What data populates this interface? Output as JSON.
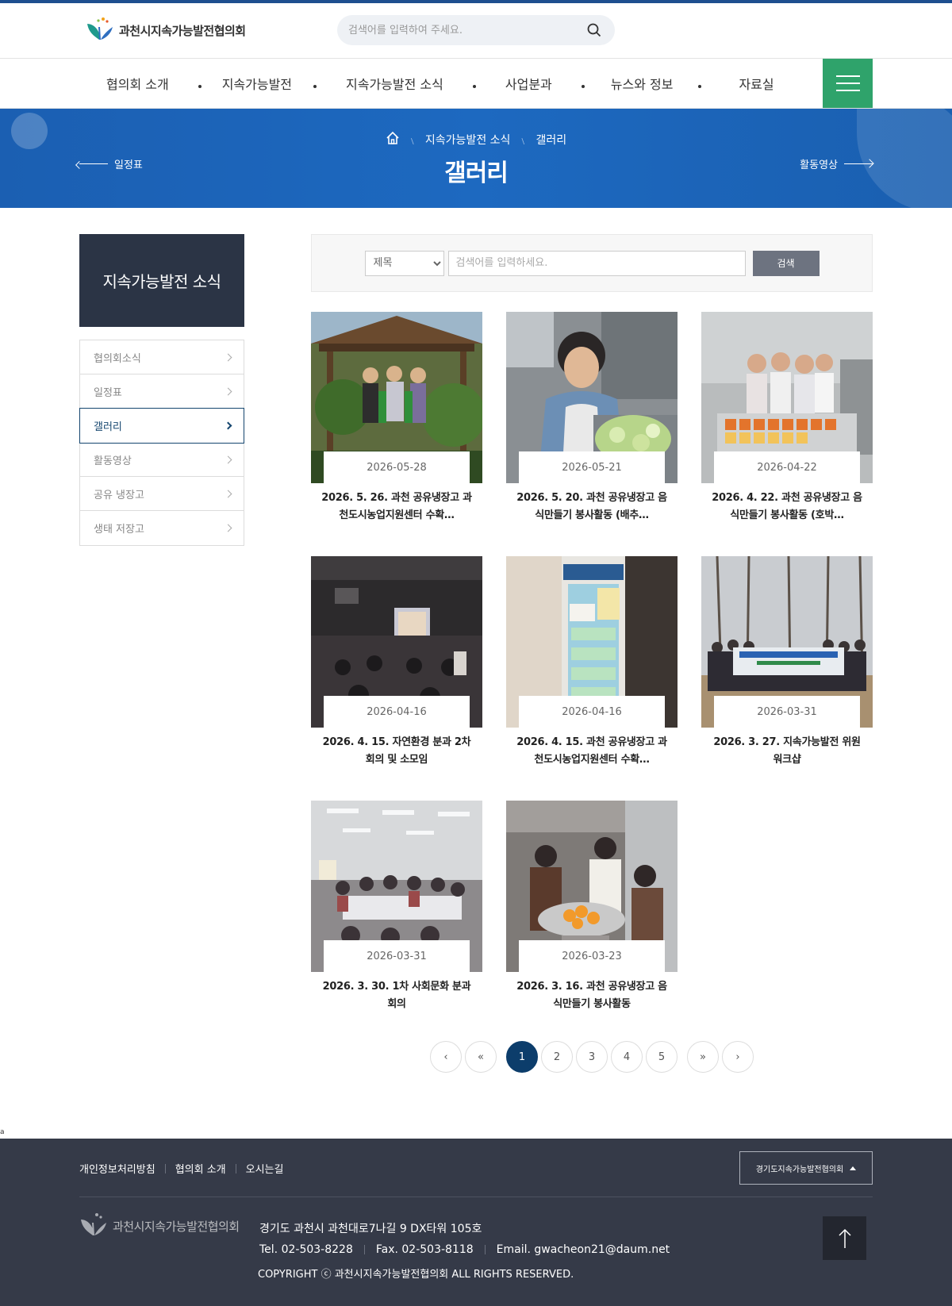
{
  "header": {
    "logo_text": "과천시지속가능발전협의회",
    "search_placeholder": "검색어를 입력하여 주세요."
  },
  "nav": {
    "items": [
      "협의회 소개",
      "지속가능발전",
      "지속가능발전 소식",
      "사업분과",
      "뉴스와 정보",
      "자료실"
    ]
  },
  "banner": {
    "breadcrumb": [
      "지속가능발전 소식",
      "갤러리"
    ],
    "title": "갤러리",
    "prev_label": "일정표",
    "next_label": "활동영상"
  },
  "sidebar": {
    "title": "지속가능발전 소식",
    "items": [
      {
        "label": "협의회소식",
        "active": false
      },
      {
        "label": "일정표",
        "active": false
      },
      {
        "label": "갤러리",
        "active": true
      },
      {
        "label": "활동영상",
        "active": false
      },
      {
        "label": "공유 냉장고",
        "active": false
      },
      {
        "label": "생태 저장고",
        "active": false
      }
    ]
  },
  "board_search": {
    "select_value": "제목",
    "input_placeholder": "검색어를 입력하세요.",
    "button_label": "검색"
  },
  "gallery": [
    {
      "date": "2026-05-28",
      "title": "2026. 5. 26. 과천 공유냉장고 과천도시농업지원센터 수확…",
      "scene": "garden"
    },
    {
      "date": "2026-05-21",
      "title": "2026. 5. 20. 과천 공유냉장고 음식만들기 봉사활동 (배추…",
      "scene": "kitchen"
    },
    {
      "date": "2026-04-22",
      "title": "2026. 4. 22. 과천 공유냉장고 음식만들기 봉사활동 (호박…",
      "scene": "group-kitchen"
    },
    {
      "date": "2026-04-16",
      "title": "2026. 4. 15. 자연환경 분과 2차 회의 및 소모임",
      "scene": "meeting-dark"
    },
    {
      "date": "2026-04-16",
      "title": "2026. 4. 15. 과천 공유냉장고 과천도시농업지원센터 수확…",
      "scene": "fridge"
    },
    {
      "date": "2026-03-31",
      "title": "2026. 3. 27. 지속가능발전 위원워크샵",
      "scene": "outdoor-group"
    },
    {
      "date": "2026-03-31",
      "title": "2026. 3. 30. 1차 사회문화 분과 회의",
      "scene": "meeting-room"
    },
    {
      "date": "2026-03-23",
      "title": "2026. 3. 16. 과천 공유냉장고 음식만들기 봉사활동",
      "scene": "cooking"
    }
  ],
  "pagination": {
    "prev": "‹",
    "first": "«",
    "pages": [
      "1",
      "2",
      "3",
      "4",
      "5"
    ],
    "current": "1",
    "last": "»",
    "next": "›"
  },
  "stray_text": "a",
  "footer": {
    "links": [
      "개인정보처리방침",
      "협의회 소개",
      "오시는길"
    ],
    "family_site": "경기도지속가능발전협의회",
    "logo_text": "과천시지속가능발전협의회",
    "address": "경기도 과천시 과천대로7나길 9 DX타워 105호",
    "tel": "Tel. 02-503-8228",
    "fax": "Fax. 02-503-8118",
    "email": "Email. gwacheon21@daum.net",
    "copyright": "COPYRIGHT ⓒ 과천시지속가능발전협의회 ALL RIGHTS RESERVED."
  },
  "colors": {
    "brand_blue": "#1d69c0",
    "menu_green": "#2fa36b",
    "sidebar_dark": "#2b3445",
    "active_page": "#0c3d6b",
    "footer_bg": "#353a48"
  }
}
